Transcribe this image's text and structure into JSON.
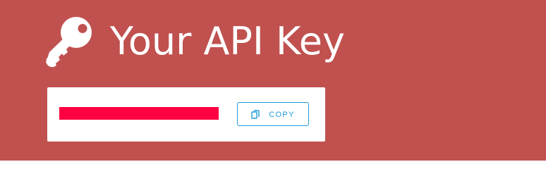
{
  "theme": {
    "background": "#C0514F",
    "card_background": "#FFFFFF",
    "redaction_color": "#FF0040",
    "accent": "#1F9AD6"
  },
  "header": {
    "icon": "key-icon",
    "title": "Your API Key"
  },
  "api_key": {
    "value_visible": false,
    "redaction": "redacted-bar"
  },
  "copy_button": {
    "icon": "copy-icon",
    "label": "COPY"
  }
}
